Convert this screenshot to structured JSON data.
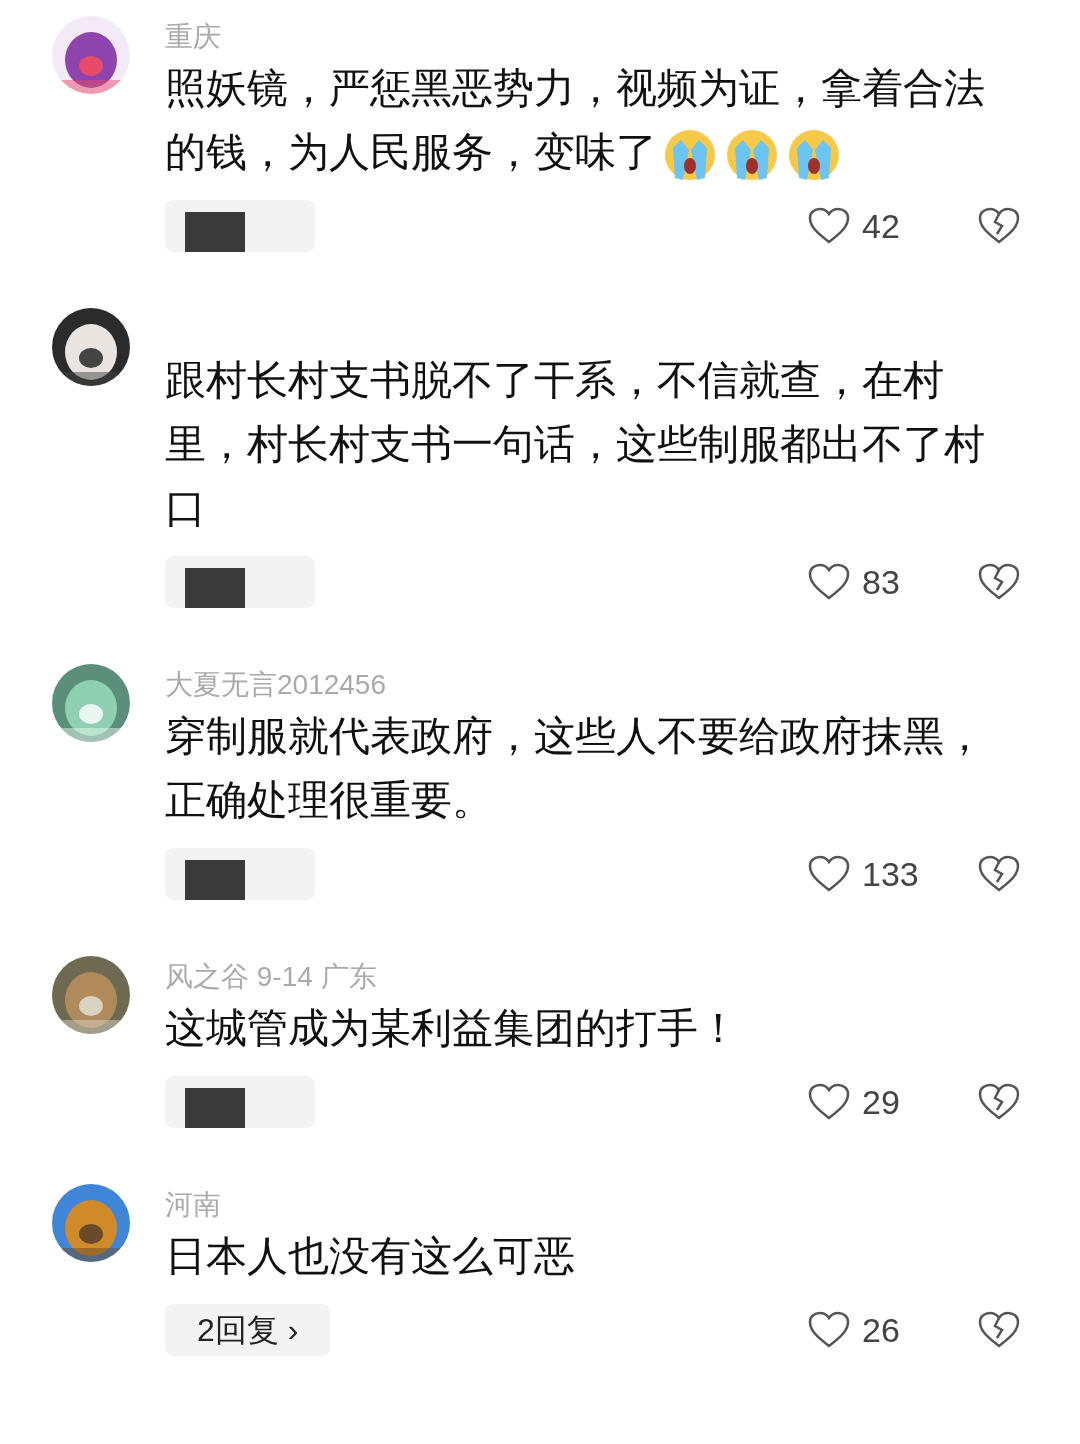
{
  "comments": [
    {
      "meta": "重庆",
      "text": "照妖镜，严惩黑恶势力，视频为证，拿着合法的钱，为人民服务，变味了",
      "reactions": [
        {
          "kind": "cry"
        },
        {
          "kind": "cry"
        },
        {
          "kind": "cry"
        }
      ],
      "reply": {
        "kind": "redacted"
      },
      "likes": "42"
    },
    {
      "text": "跟村长村支书脱不了干系，不信就查，在村里，村长村支书一句话，这些制服都出不了村口",
      "reply": {
        "kind": "redacted"
      },
      "likes": "83"
    },
    {
      "meta": "大夏无言2012456",
      "text": "穿制服就代表政府，这些人不要给政府抹黑，正确处理很重要。",
      "reply": {
        "kind": "redacted"
      },
      "likes": "133"
    },
    {
      "meta": "风之谷 9-14 广东",
      "text": "这城管成为某利益集团的打手！",
      "reply": {
        "kind": "redacted"
      },
      "likes": "29"
    },
    {
      "meta": "河南",
      "text": "日本人也没有这么可恶",
      "reply": {
        "kind": "label",
        "label": "2回复 ›"
      },
      "likes": "26"
    }
  ]
}
